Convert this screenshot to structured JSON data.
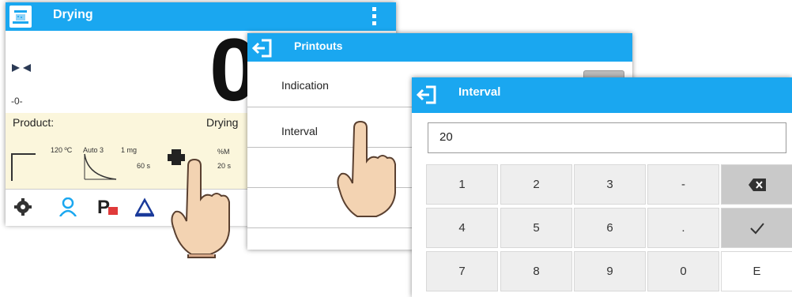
{
  "main": {
    "title": "Drying",
    "display": {
      "value": "0",
      "zero_indicator": "-0-"
    },
    "info": {
      "product_label": "Product:",
      "mode_label": "Drying"
    },
    "params": {
      "temperature": "120 ºC",
      "mode": "Auto 3",
      "resolution": "1 mg",
      "time": "60 s",
      "unit": "%M",
      "interval": "20 s"
    },
    "toolbar": [
      "gear-icon",
      "user-icon",
      "product-icon",
      "tare-icon"
    ]
  },
  "printouts": {
    "title": "Printouts",
    "items": [
      "Indication",
      "Interval"
    ]
  },
  "interval": {
    "title": "Interval",
    "value": "20",
    "keys": [
      "1",
      "2",
      "3",
      "-",
      "",
      "4",
      "5",
      "6",
      ".",
      "",
      "7",
      "8",
      "9",
      "0",
      "E"
    ]
  },
  "colors": {
    "accent": "#1aa7f0",
    "info_bg": "#fbf6dc"
  }
}
